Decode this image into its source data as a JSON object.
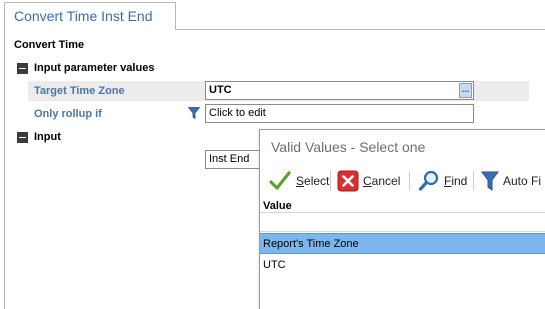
{
  "tab": {
    "title": "Convert Time Inst End"
  },
  "panel": {
    "section_title": "Convert Time",
    "groups": {
      "input_params": {
        "label": "Input parameter values"
      },
      "input": {
        "label": "Input"
      }
    },
    "properties": {
      "target_time_zone": {
        "label": "Target Time Zone",
        "value": "UTC"
      },
      "only_rollup_if": {
        "label": "Only rollup if",
        "value": "Click to edit"
      },
      "input_value": {
        "value": "Inst End"
      }
    },
    "ellipsis_label": "..."
  },
  "popup": {
    "title": "Valid Values - Select one",
    "toolbar": {
      "select": {
        "label_rest": "elect",
        "underline": "S"
      },
      "cancel": {
        "label_rest": "ancel",
        "underline": "C"
      },
      "find": {
        "label_rest": "ind",
        "underline": "F"
      },
      "autofit": {
        "label": "Auto Fi"
      }
    },
    "column_header": "Value",
    "rows": [
      "Report's Time Zone",
      "UTC"
    ],
    "selected_index": 0
  },
  "colors": {
    "accent": "#3d6ea9",
    "label_blue": "#4b76aa",
    "selection": "#7cb6ec",
    "cancel_red": "#d9302e",
    "check_green": "#5aa526"
  }
}
